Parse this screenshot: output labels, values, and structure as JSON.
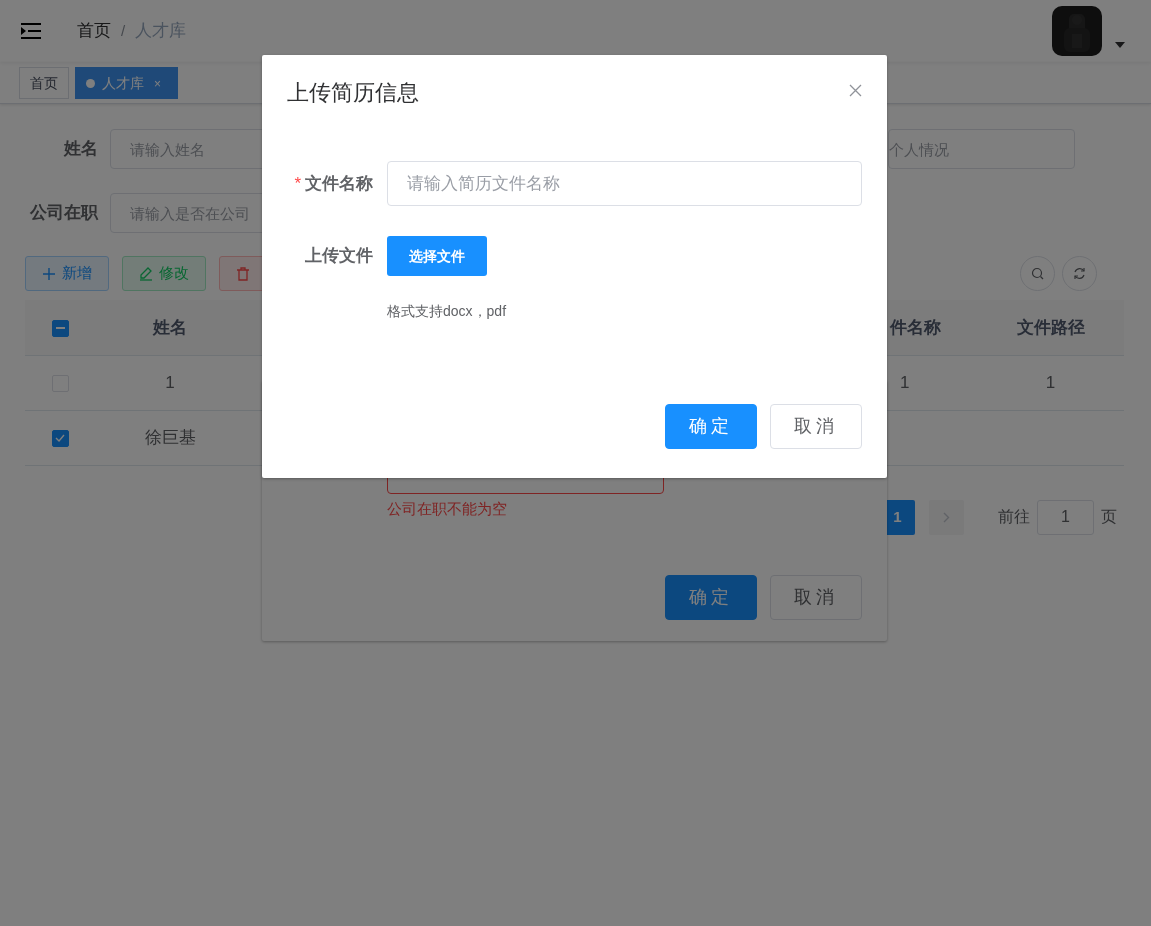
{
  "topbar": {
    "breadcrumb": [
      "首页",
      "人才库"
    ],
    "separator": "/"
  },
  "tags": [
    {
      "label": "首页",
      "selected": false
    },
    {
      "label": "人才库",
      "selected": true,
      "close": "×"
    }
  ],
  "search_form": {
    "rows": [
      {
        "label": "姓名",
        "placeholder": "请输入姓名",
        "right_placeholder": "个人情况"
      },
      {
        "label": "公司在职",
        "placeholder": "请输入是否在公司"
      }
    ]
  },
  "toolbar": {
    "buttons": [
      {
        "kind": "add",
        "label": "新增"
      },
      {
        "kind": "edit",
        "label": "修改"
      },
      {
        "kind": "delete"
      }
    ]
  },
  "table": {
    "columns": [
      "姓名",
      "件名称",
      "文件路径"
    ],
    "header_indeterminate": true,
    "rows": [
      {
        "selected": false,
        "cells": [
          "1",
          "1",
          "1"
        ]
      },
      {
        "selected": true,
        "cells": [
          "徐巨基"
        ]
      }
    ]
  },
  "pagination": {
    "pages": [
      {
        "label": "1",
        "selected": true
      }
    ],
    "goto_label": "前往",
    "goto_value": "1",
    "goto_suffix": "页"
  },
  "back_dialog": {
    "error": "公司在职不能为空",
    "buttons": [
      {
        "kind": "primary",
        "label": "确定"
      },
      {
        "kind": "default",
        "label": "取消"
      }
    ]
  },
  "dialog": {
    "title": "上传简历信息",
    "fields": [
      {
        "kind": "input",
        "label": "文件名称",
        "required_mark": "*",
        "placeholder": "请输入简历文件名称"
      },
      {
        "kind": "upload",
        "label": "上传文件",
        "button": "选择文件",
        "tip": "格式支持docx，pdf"
      }
    ],
    "buttons": [
      {
        "kind": "primary",
        "label": "确定"
      },
      {
        "kind": "default",
        "label": "取消"
      }
    ]
  }
}
